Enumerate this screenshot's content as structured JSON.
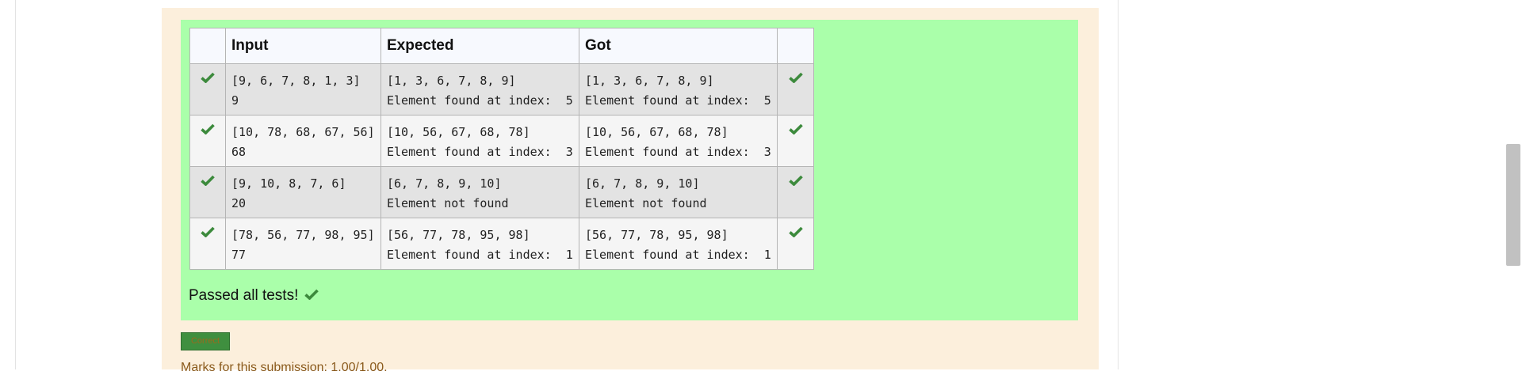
{
  "table": {
    "headers": [
      "",
      "Input",
      "Expected",
      "Got",
      ""
    ],
    "rows": [
      {
        "input_line1": "[9, 6, 7, 8, 1, 3]",
        "input_line2": "9",
        "expected_line1": "[1, 3, 6, 7, 8, 9]",
        "expected_line2": "Element found at index:  5",
        "got_line1": "[1, 3, 6, 7, 8, 9]",
        "got_line2": "Element found at index:  5"
      },
      {
        "input_line1": "[10, 78, 68, 67, 56]",
        "input_line2": "68",
        "expected_line1": "[10, 56, 67, 68, 78]",
        "expected_line2": "Element found at index:  3",
        "got_line1": "[10, 56, 67, 68, 78]",
        "got_line2": "Element found at index:  3"
      },
      {
        "input_line1": "[9, 10, 8, 7, 6]",
        "input_line2": "20",
        "expected_line1": "[6, 7, 8, 9, 10]",
        "expected_line2": "Element not found",
        "got_line1": "[6, 7, 8, 9, 10]",
        "got_line2": "Element not found"
      },
      {
        "input_line1": "[78, 56, 77, 98, 95]",
        "input_line2": "77",
        "expected_line1": "[56, 77, 78, 95, 98]",
        "expected_line2": "Element found at index:  1",
        "got_line1": "[56, 77, 78, 95, 98]",
        "got_line2": "Element found at index:  1"
      }
    ]
  },
  "summary": {
    "passed_text": "Passed all tests!",
    "badge_label": "Correct",
    "marks_text": "Marks for this submission: 1.00/1.00."
  },
  "icons": {
    "tick": "check-icon"
  },
  "colors": {
    "pass_background": "#aaffaa",
    "outcome_background": "#fcefdc",
    "tick_green": "#3c8a3c",
    "marks_text": "#8a5a1c"
  }
}
